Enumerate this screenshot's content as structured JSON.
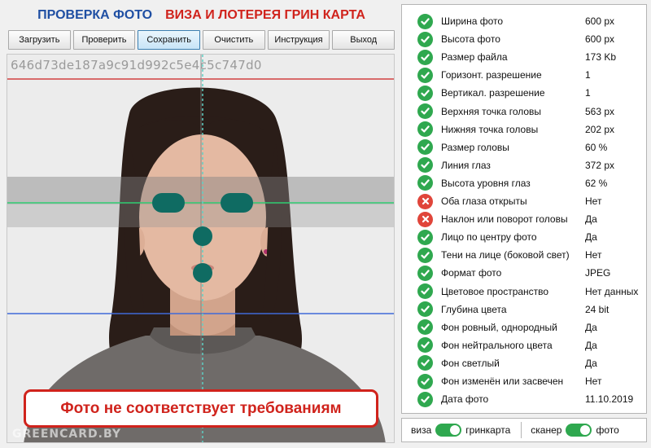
{
  "header": {
    "title_left": "ПРОВЕРКА ФОТО",
    "title_right": "ВИЗА И ЛОТЕРЕЯ ГРИН КАРТА"
  },
  "toolbar": {
    "load": "Загрузить",
    "check": "Проверить",
    "save": "Сохранить",
    "clear": "Очистить",
    "help": "Инструкция",
    "exit": "Выход"
  },
  "photo": {
    "hash": "646d73de187a9c91d992c5e4c5c747d0",
    "watermark": "GREENCARD.BY",
    "verdict": "Фото не соответствует требованиям"
  },
  "checks": [
    {
      "label": "Ширина фото",
      "value": "600 px",
      "status": "ok"
    },
    {
      "label": "Высота фото",
      "value": "600 px",
      "status": "ok"
    },
    {
      "label": "Размер файла",
      "value": "173 Kb",
      "status": "ok"
    },
    {
      "label": "Горизонт. разрешение",
      "value": "1",
      "status": "ok"
    },
    {
      "label": "Вертикал. разрешение",
      "value": "1",
      "status": "ok"
    },
    {
      "label": "Верхняя точка головы",
      "value": "563 px",
      "status": "ok"
    },
    {
      "label": "Нижняя точка головы",
      "value": "202 px",
      "status": "ok"
    },
    {
      "label": "Размер головы",
      "value": "60 %",
      "status": "ok"
    },
    {
      "label": "Линия глаз",
      "value": "372 px",
      "status": "ok"
    },
    {
      "label": "Высота уровня глаз",
      "value": "62 %",
      "status": "ok"
    },
    {
      "label": "Оба глаза открыты",
      "value": "Нет",
      "status": "fail"
    },
    {
      "label": "Наклон или поворот головы",
      "value": "Да",
      "status": "fail"
    },
    {
      "label": "Лицо по центру фото",
      "value": "Да",
      "status": "ok"
    },
    {
      "label": "Тени на лице (боковой свет)",
      "value": "Нет",
      "status": "ok"
    },
    {
      "label": "Формат фото",
      "value": "JPEG",
      "status": "ok"
    },
    {
      "label": "Цветовое пространство",
      "value": "Нет данных",
      "status": "ok"
    },
    {
      "label": "Глубина цвета",
      "value": "24 bit",
      "status": "ok"
    },
    {
      "label": "Фон ровный, однородный",
      "value": "Да",
      "status": "ok"
    },
    {
      "label": "Фон нейтрального цвета",
      "value": "Да",
      "status": "ok"
    },
    {
      "label": "Фон светлый",
      "value": "Да",
      "status": "ok"
    },
    {
      "label": "Фон изменён или засвечен",
      "value": "Нет",
      "status": "ok"
    },
    {
      "label": "Дата фото",
      "value": "11.10.2019",
      "status": "ok"
    }
  ],
  "switches": {
    "left_off": "виза",
    "left_on": "гринкарта",
    "left_state": "on",
    "right_off": "сканер",
    "right_on": "фото",
    "right_state": "on"
  },
  "colors": {
    "title_blue": "#1f4fa3",
    "title_red": "#d0231c",
    "ok": "#2fa84f",
    "fail": "#e0453a",
    "marker": "#0f6b62"
  }
}
